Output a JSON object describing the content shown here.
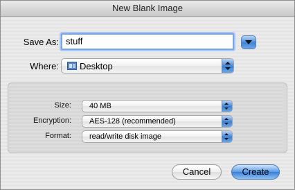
{
  "window": {
    "title": "New Blank Image"
  },
  "save_as": {
    "label": "Save As:",
    "value": "stuff"
  },
  "where": {
    "label": "Where:",
    "value": "Desktop",
    "icon": "desktop-folder-icon"
  },
  "options": {
    "size": {
      "label": "Size:",
      "value": "40 MB"
    },
    "encryption": {
      "label": "Encryption:",
      "value": "AES-128 (recommended)"
    },
    "format": {
      "label": "Format:",
      "value": "read/write disk image"
    }
  },
  "buttons": {
    "cancel": "Cancel",
    "create": "Create"
  },
  "colors": {
    "accent": "#3a82d6",
    "focus_ring": "#7aa5e0"
  }
}
